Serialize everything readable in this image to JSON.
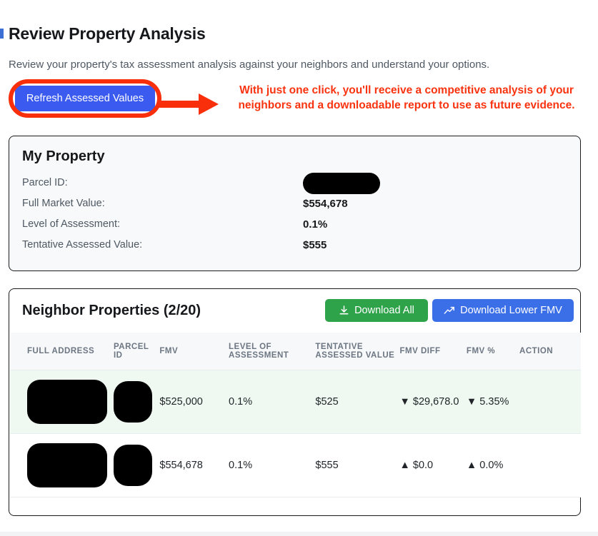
{
  "header": {
    "title": "Review Property Analysis",
    "subtitle": "Review your property's tax assessment analysis against your neighbors and understand your options.",
    "refresh_button": "Refresh Assessed Values"
  },
  "annotation": {
    "text": "With just one click, you'll receive a competitive analysis of your neighbors and a downloadable report to use as future evidence.",
    "color": "#f9330f",
    "arrow_icon": "right-arrow-icon"
  },
  "my_property": {
    "title": "My Property",
    "rows": [
      {
        "label": "Parcel ID:",
        "value": "",
        "redacted": true
      },
      {
        "label": "Full Market Value:",
        "value": "$554,678",
        "redacted": false
      },
      {
        "label": "Level of Assessment:",
        "value": "0.1%",
        "redacted": false
      },
      {
        "label": "Tentative Assessed Value:",
        "value": "$555",
        "redacted": false
      }
    ]
  },
  "neighbors": {
    "title": "Neighbor Properties (2/20)",
    "download_all_label": "Download All",
    "download_all_icon": "download-icon",
    "download_all_color": "#2fa34a",
    "download_lower_label": "Download Lower FMV",
    "download_lower_icon": "trending-up-icon",
    "download_lower_color": "#3b6fe8",
    "columns": [
      "FULL ADDRESS",
      "PARCEL ID",
      "FMV",
      "LEVEL OF ASSESSMENT",
      "TENTATIVE ASSESSED VALUE",
      "FMV DIFF",
      "FMV %",
      "ACTION"
    ],
    "rows": [
      {
        "address": "",
        "parcel_id": "",
        "fmv": "$525,000",
        "level_of_assessment": "0.1%",
        "tentative_assessed_value": "$525",
        "fmv_diff": "▼ $29,678.0",
        "fmv_pct": "▼ 5.35%",
        "action": "",
        "trend": "down",
        "highlight": "lower"
      },
      {
        "address": "",
        "parcel_id": "",
        "fmv": "$554,678",
        "level_of_assessment": "0.1%",
        "tentative_assessed_value": "$555",
        "fmv_diff": "▲ $0.0",
        "fmv_pct": "▲ 0.0%",
        "action": "",
        "trend": "up",
        "highlight": "none"
      }
    ]
  }
}
